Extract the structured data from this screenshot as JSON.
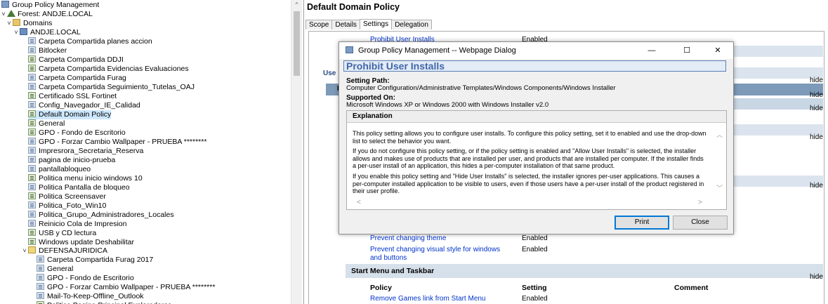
{
  "tree": {
    "root": "Group Policy Management",
    "forest": "Forest: ANDJE.LOCAL",
    "domains": "Domains",
    "domain": "ANDJE.LOCAL",
    "items": [
      {
        "label": "Carpeta Compartida planes accion",
        "icon": "gpo"
      },
      {
        "label": "Bitlocker",
        "icon": "gpo"
      },
      {
        "label": "Carpeta Compartida DDJI",
        "icon": "gpo-linked"
      },
      {
        "label": "Carpeta Compartida Evidencias Evaluaciones",
        "icon": "gpo-linked"
      },
      {
        "label": "Carpeta Compartida Furag",
        "icon": "gpo"
      },
      {
        "label": "Carpeta Compartida Seguimiento_Tutelas_OAJ",
        "icon": "gpo"
      },
      {
        "label": "Certificado SSL Fortinet",
        "icon": "gpo-linked"
      },
      {
        "label": "Config_Navegador_IE_Calidad",
        "icon": "gpo"
      },
      {
        "label": "Default Domain Policy",
        "icon": "gpo-linked",
        "selected": true
      },
      {
        "label": "General",
        "icon": "gpo-linked"
      },
      {
        "label": "GPO - Fondo de Escritorio",
        "icon": "gpo-linked"
      },
      {
        "label": "GPO - Forzar Cambio Wallpaper - PRUEBA ********",
        "icon": "gpo"
      },
      {
        "label": "Impresrora_Secretaria_Reserva",
        "icon": "gpo"
      },
      {
        "label": "pagina de inicio-prueba",
        "icon": "gpo"
      },
      {
        "label": "pantallabloqueo",
        "icon": "gpo"
      },
      {
        "label": "Politica menu inicio windows 10",
        "icon": "gpo-linked"
      },
      {
        "label": "Politica Pantalla de bloqueo",
        "icon": "gpo"
      },
      {
        "label": "Politica Screensaver",
        "icon": "gpo-linked"
      },
      {
        "label": "Politica_Foto_Win10",
        "icon": "gpo"
      },
      {
        "label": "Politica_Grupo_Administradores_Locales",
        "icon": "gpo"
      },
      {
        "label": "Reinicio Cola de Impresion",
        "icon": "gpo"
      },
      {
        "label": "USB y CD lectura",
        "icon": "gpo-linked"
      },
      {
        "label": "Windows update Deshabilitar",
        "icon": "gpo-linked"
      }
    ],
    "ou": "DEFENSAJURIDICA",
    "ou_items": [
      {
        "label": "Carpeta Compartida Furag 2017",
        "icon": "gpo"
      },
      {
        "label": "General",
        "icon": "gpo"
      },
      {
        "label": "GPO - Fondo de Escritorio",
        "icon": "gpo"
      },
      {
        "label": "GPO - Forzar Cambio Wallpaper - PRUEBA ********",
        "icon": "gpo"
      },
      {
        "label": "Mail-To-Keep-Offline_Outlook",
        "icon": "gpo"
      },
      {
        "label": "Politica Pagina Principal Exploradores",
        "icon": "gpo-linked"
      }
    ]
  },
  "right": {
    "title": "Default Domain Policy",
    "tabs": [
      "Scope",
      "Details",
      "Settings",
      "Delegation"
    ],
    "active_tab": "Settings",
    "top_row": {
      "policy": "Prohibit User Installs",
      "setting": "Enabled"
    },
    "hide": "hide",
    "fragments": {
      "use": "Use",
      "p": "Pr",
      "a": "A"
    },
    "rows": [
      {
        "policy": "Prevent changing theme",
        "setting": "Enabled"
      },
      {
        "policy": "Prevent changing visual style for windows and buttons",
        "setting": "Enabled"
      }
    ],
    "section": "Start Menu and Taskbar",
    "columns": {
      "policy": "Policy",
      "setting": "Setting",
      "comment": "Comment"
    },
    "last_row": {
      "policy": "Remove Games link from Start Menu",
      "setting": "Enabled"
    }
  },
  "dialog": {
    "title": "Group Policy Management -- Webpage Dialog",
    "policy_name": "Prohibit User Installs",
    "setting_path_label": "Setting Path:",
    "setting_path": "Computer Configuration/Administrative Templates/Windows Components/Windows Installer",
    "supported_label": "Supported On:",
    "supported": "Microsoft Windows XP or Windows 2000 with Windows Installer v2.0",
    "explanation_label": "Explanation",
    "explanation": [
      "This policy setting allows you to configure user installs. To configure this policy setting, set it to enabled and use the drop-down list to select the behavior you want.",
      "If you do not configure this policy setting, or if the policy setting is enabled and \"Allow User Installs\" is selected, the installer allows and makes use of products that are installed per user, and products that are installed per computer. If the installer finds a per-user install of an application, this hides a per-computer installation of that same product.",
      "If you enable this policy setting and \"Hide User Installs\" is selected, the installer ignores per-user applications. This causes a per-computer installed application to be visible to users, even if those users have a per-user install of the product registered in their user profile."
    ],
    "print": "Print",
    "close": "Close",
    "minimize": "—",
    "maximize": "☐",
    "close_x": "✕"
  }
}
